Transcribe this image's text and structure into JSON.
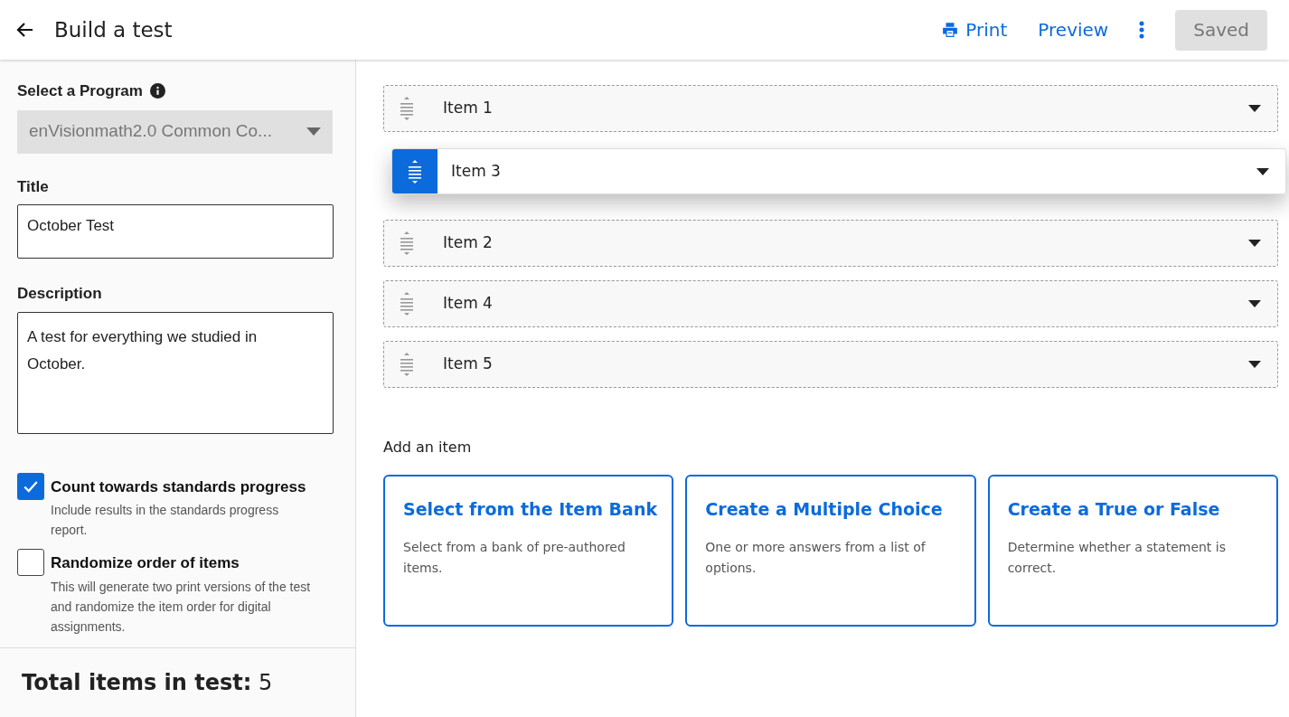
{
  "header": {
    "title": "Build a test",
    "actions": [
      {
        "kind": "print",
        "label": "Print"
      },
      {
        "kind": "link",
        "label": "Preview"
      },
      {
        "kind": "more"
      },
      {
        "kind": "status",
        "label": "Saved",
        "disabled": true
      }
    ]
  },
  "sidebar": {
    "program": {
      "label": "Select a Program",
      "value": "enVisionmath2.0 Common Co...",
      "disabled": true
    },
    "title": {
      "label": "Title",
      "value": "October Test"
    },
    "description": {
      "label": "Description",
      "value": "A test for everything we studied in October."
    },
    "options": [
      {
        "label": "Count towards standards progress",
        "hint": "Include results in the standards progress report.",
        "checked": true
      },
      {
        "label": "Randomize order of items",
        "hint": "This will generate two print versions of the test and randomize the item order for digital assignments.",
        "checked": false
      }
    ],
    "total": "**Total items in test:** 5"
  },
  "items": [
    {
      "label": "Item 1",
      "dragging": false
    },
    {
      "label": "Item 3",
      "dragging": true
    },
    {
      "label": "Item 2",
      "dragging": false
    },
    {
      "label": "Item 4",
      "dragging": false
    },
    {
      "label": "Item 5",
      "dragging": false
    }
  ],
  "add": {
    "heading": "Add an item",
    "cards": [
      {
        "title": "Select from the Item Bank",
        "text": "Select from a bank of pre-authored items."
      },
      {
        "title": "Create a Multiple Choice",
        "text": "One or more answers from a list of options."
      },
      {
        "title": "Create a True or False",
        "text": "Determine whether a statement is correct."
      }
    ]
  }
}
